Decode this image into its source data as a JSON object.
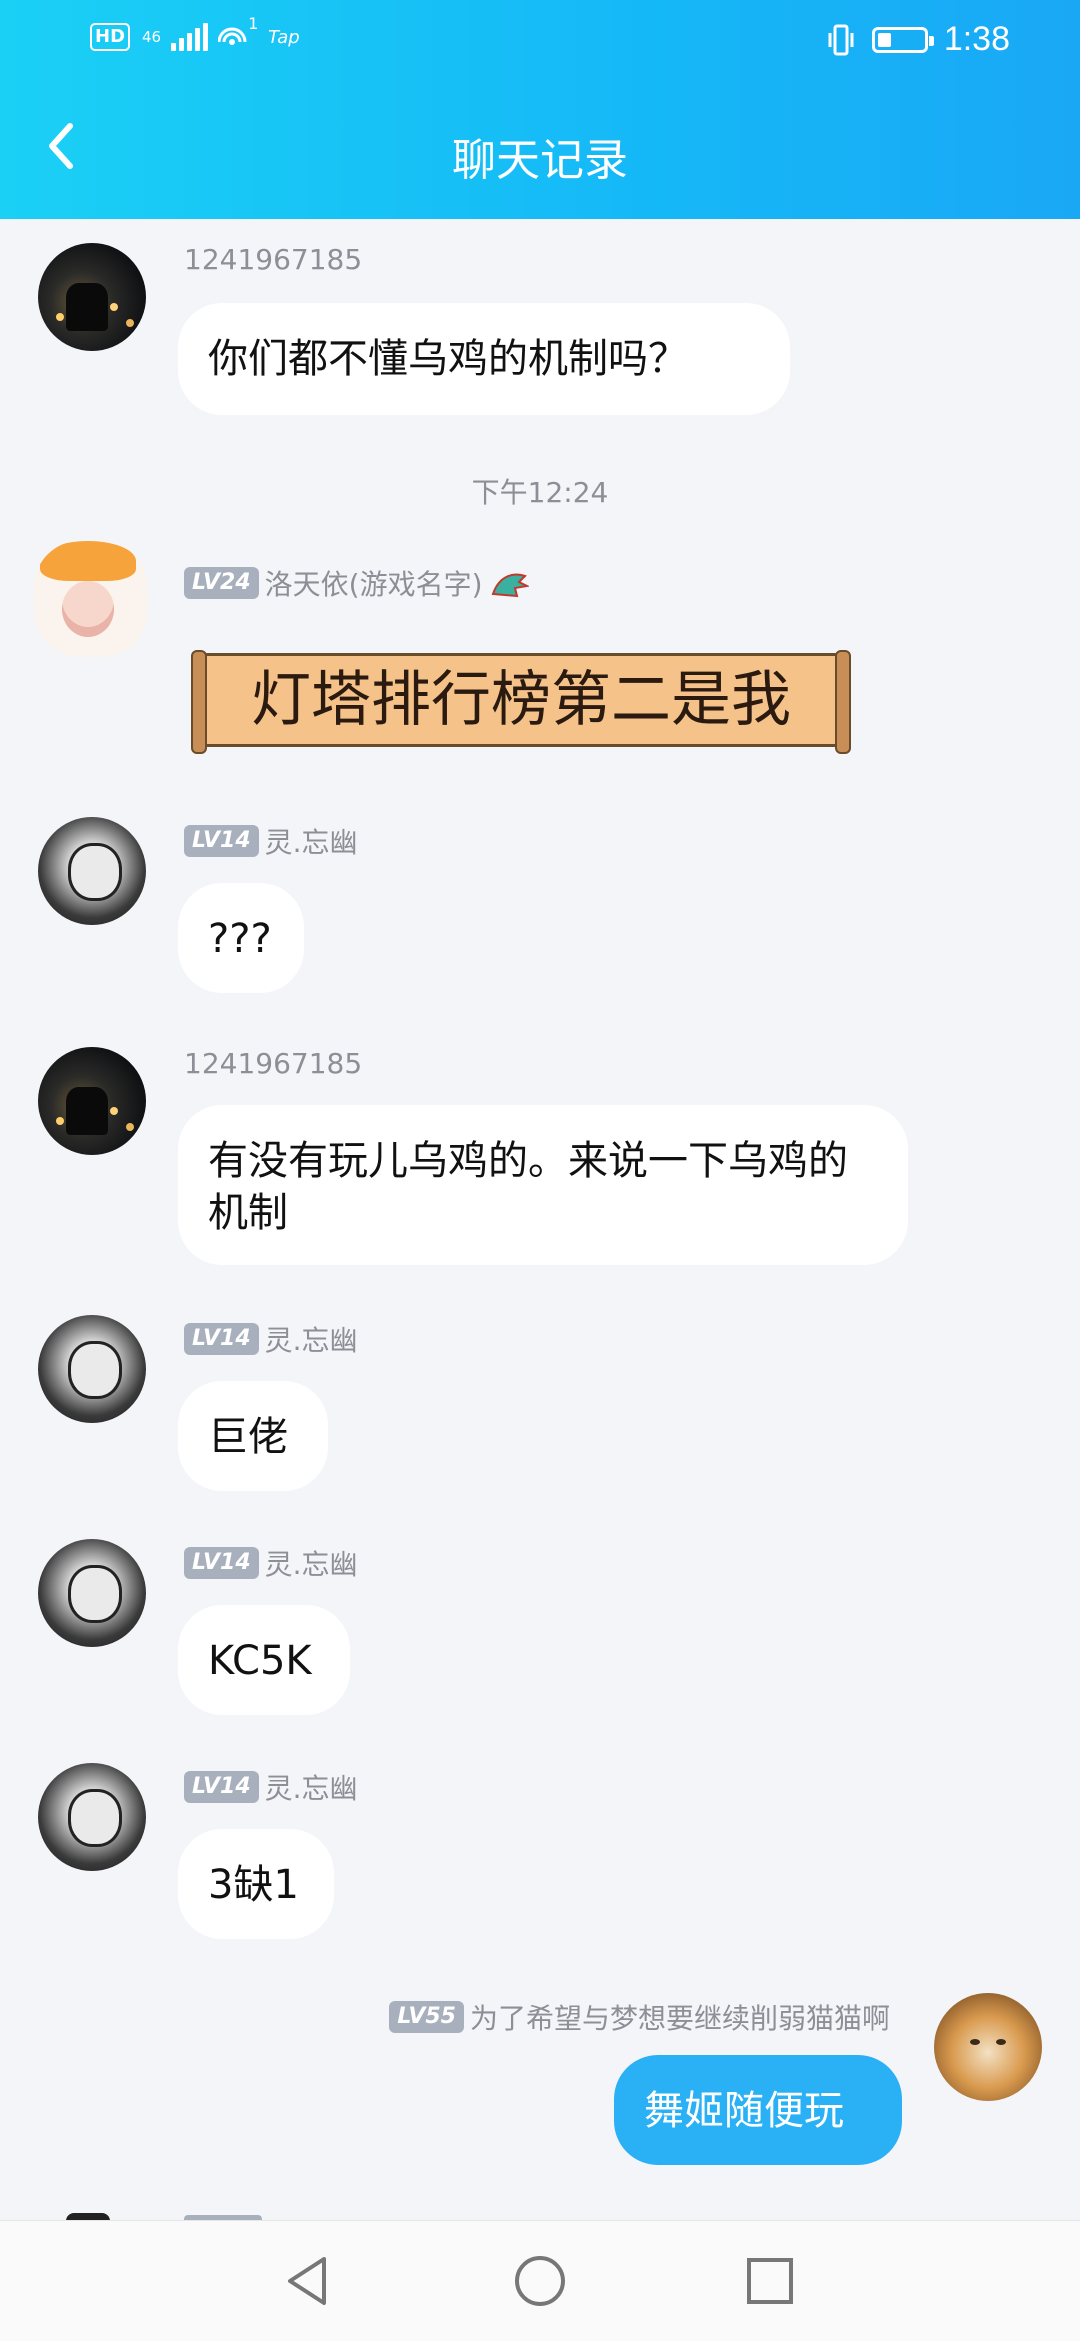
{
  "status_bar": {
    "hd": "HD",
    "network": "46",
    "hotspot_count": "1",
    "tap": "Tap",
    "time": "1:38",
    "battery_level": 0.3
  },
  "header": {
    "title": "聊天记录"
  },
  "messages": [
    {
      "sender": "1241967185",
      "text": "你们都不懂乌鸡的机制吗？"
    },
    {
      "timestamp": "下午12:24"
    },
    {
      "level": "LV24",
      "sender": "洛天依(游戏名字)",
      "text": "灯塔排行榜第二是我"
    },
    {
      "level": "LV14",
      "sender": "灵.忘幽",
      "text": "???"
    },
    {
      "sender": "1241967185",
      "text": "有没有玩儿乌鸡的。来说一下乌鸡的机制"
    },
    {
      "level": "LV14",
      "sender": "灵.忘幽",
      "text": "巨佬"
    },
    {
      "level": "LV14",
      "sender": "灵.忘幽",
      "text": "KC5K"
    },
    {
      "level": "LV14",
      "sender": "灵.忘幽",
      "text": "3缺1"
    },
    {
      "level": "LV55",
      "sender": "为了希望与梦想要继续削弱猫猫啊",
      "text": "舞姬随便玩"
    }
  ],
  "icons": {
    "back": "chevron-left-icon",
    "nav_back": "triangle-back-icon",
    "nav_home": "circle-home-icon",
    "nav_recents": "square-recents-icon"
  },
  "colors": {
    "header_gradient_start": "#1ad0f5",
    "header_gradient_end": "#1aa8f5",
    "my_bubble": "#2ab0f5",
    "background": "#f4f5f9"
  }
}
